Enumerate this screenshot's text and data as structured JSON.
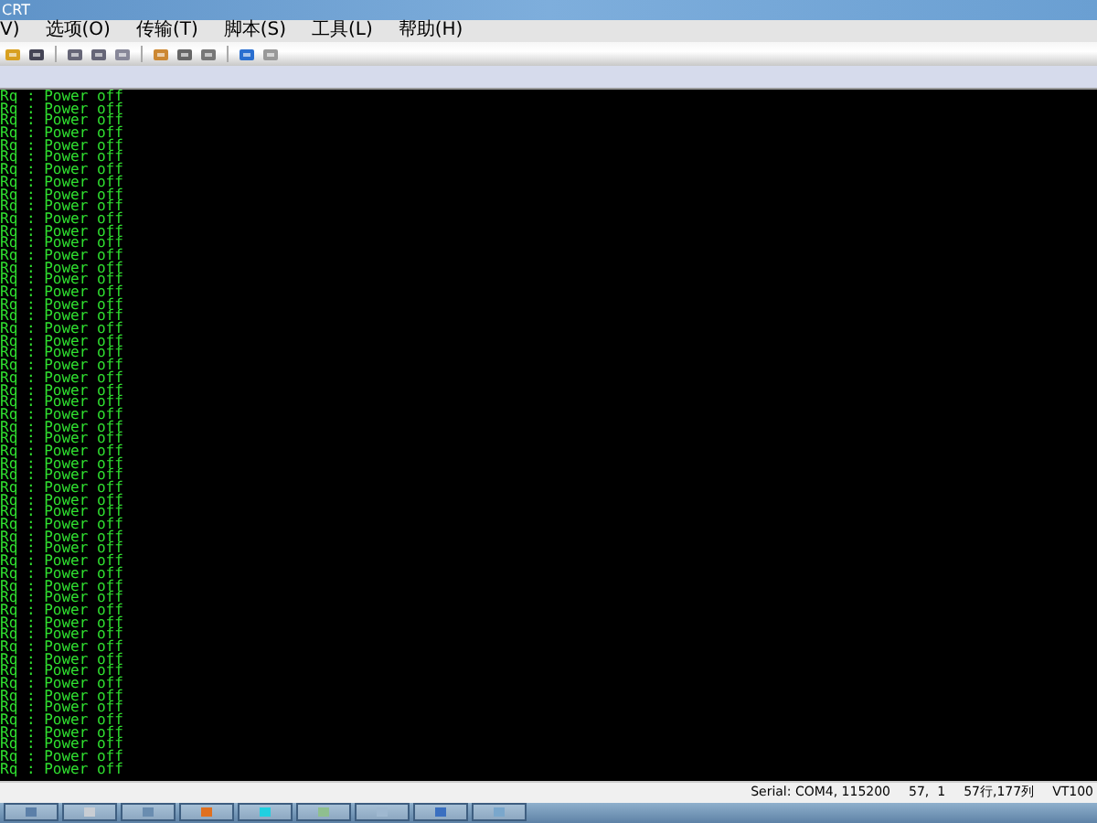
{
  "window": {
    "title": "CRT"
  },
  "menu": [
    "V)",
    "选项(O)",
    "传输(T)",
    "脚本(S)",
    "工具(L)",
    "帮助(H)"
  ],
  "terminal": {
    "lines": [
      "Rq : Power off",
      "Rq : Power off",
      "Rq : Power off",
      "Rq : Power off",
      "Rq : Power off",
      "Rq : Power off",
      "Rq : Power off",
      "Rq : Power off",
      "Rq : Power off",
      "Rq : Power off",
      "Rq : Power off",
      "Rq : Power off",
      "Rq : Power off",
      "Rq : Power off",
      "Rq : Power off",
      "Rq : Power off",
      "Rq : Power off",
      "Rq : Power off",
      "Rq : Power off",
      "Rq : Power off",
      "Rq : Power off",
      "Rq : Power off",
      "Rq : Power off",
      "Rq : Power off",
      "Rq : Power off",
      "Rq : Power off",
      "Rq : Power off",
      "Rq : Power off",
      "Rq : Power off",
      "Rq : Power off",
      "Rq : Power off",
      "Rq : Power off",
      "Rq : Power off",
      "Rq : Power off",
      "Rq : Power off",
      "Rq : Power off",
      "Rq : Power off",
      "Rq : Power off",
      "Rq : Power off",
      "Rq : Power off",
      "Rq : Power off",
      "Rq : Power off",
      "Rq : Power off",
      "Rq : Power off",
      "Rq : Power off",
      "Rq : Power off",
      "Rq : Power off",
      "Rq : Power off",
      "Rq : Power off",
      "Rq : Power off",
      "Rq : Power off",
      "Rq : Power off",
      "Rq : Power off",
      "Rq : Power off",
      "Rq : Power off",
      "Rq : Power off"
    ]
  },
  "status_bar": [
    "Serial: COM4, 115200",
    "57,  1",
    "57行,177列",
    "VT100"
  ]
}
